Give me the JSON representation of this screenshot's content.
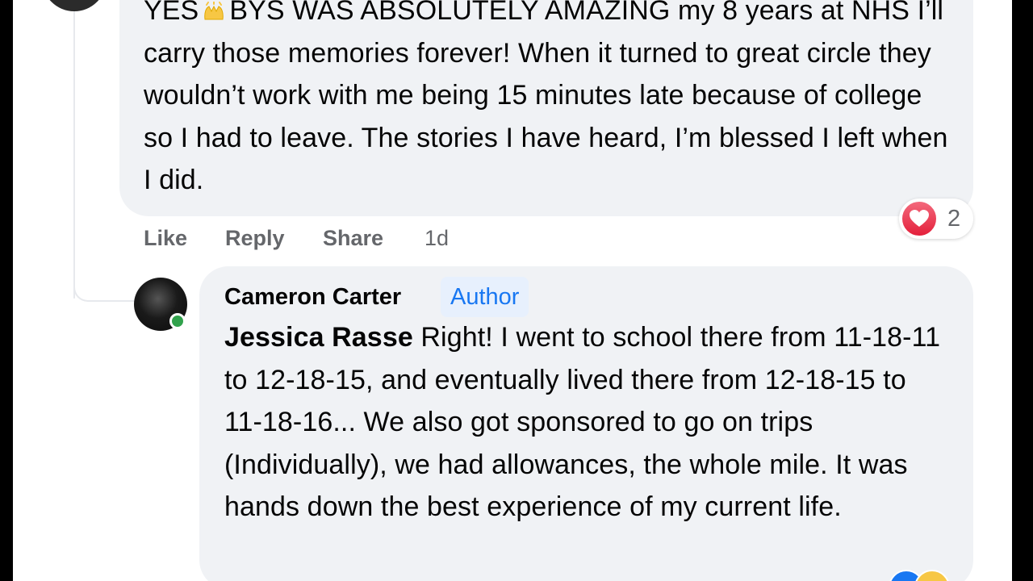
{
  "comment_1": {
    "text_before_emoji": "YES",
    "emoji": "raising-hands-emoji",
    "text_after_emoji": "BYS WAS ABSOLUTELY AMAZING my 8 years at NHS I’ll carry those memories forever! When it turned to great circle they wouldn’t work with me being 15 minutes late because of college so I had to leave. The stories I have heard, I’m blessed I left when I did.",
    "actions": {
      "like": "Like",
      "reply": "Reply",
      "share": "Share",
      "time": "1d"
    },
    "reactions": {
      "icon": "heart-icon",
      "count": "2"
    }
  },
  "reply_1": {
    "author_name": "Cameron Carter",
    "author_badge": "Author",
    "mention": "Jessica Rasse",
    "text": " Right! I went to school there from 11-18-11 to 12-18-15, and eventually lived there from 12-18-15 to 11-18-16... We also got sponsored to go on trips (Individually), we had allowances, the whole mile. It was hands down the best experience of my current life."
  },
  "colors": {
    "bubble": "#f0f2f5",
    "text": "#050505",
    "secondary": "#65676b",
    "accent": "#1877f2",
    "heart": "#e4203b"
  }
}
